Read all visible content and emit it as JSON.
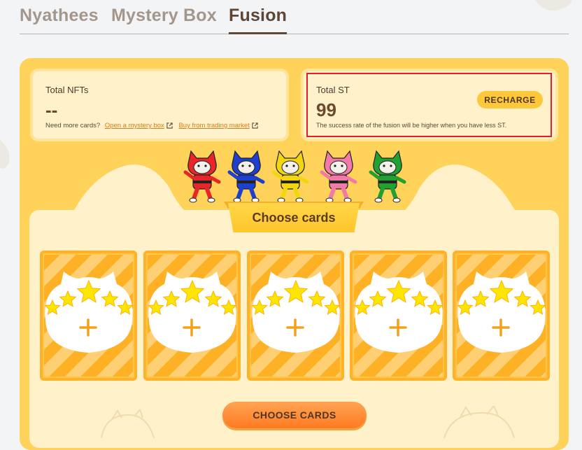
{
  "tabs": [
    {
      "label": "Nyathees",
      "active": false
    },
    {
      "label": "Mystery Box",
      "active": false
    },
    {
      "label": "Fusion",
      "active": true
    }
  ],
  "nfts": {
    "title": "Total NFTs",
    "value": "--",
    "prompt": "Need more cards?",
    "link1": "Open a mystery box",
    "link2": "Buy from trading market"
  },
  "st": {
    "title": "Total ST",
    "value": "99",
    "note": "The success rate of the fusion will be higher when you have less ST.",
    "recharge_label": "RECHARGE"
  },
  "mascots": [
    {
      "color": "#e8262a"
    },
    {
      "color": "#1f3fcf"
    },
    {
      "color": "#f2d60f"
    },
    {
      "color": "#f27aa8"
    },
    {
      "color": "#22a133"
    }
  ],
  "section": {
    "title": "Choose cards"
  },
  "slots": [
    {
      "icon": "plus-icon"
    },
    {
      "icon": "plus-icon"
    },
    {
      "icon": "plus-icon"
    },
    {
      "icon": "plus-icon"
    },
    {
      "icon": "plus-icon"
    }
  ],
  "footer": {
    "button_label": "CHOOSE CARDS"
  },
  "colors": {
    "panel": "#ffd35a",
    "accent": "#ff7a21",
    "highlight": "#e0202a",
    "text_dark": "#5e4637"
  }
}
